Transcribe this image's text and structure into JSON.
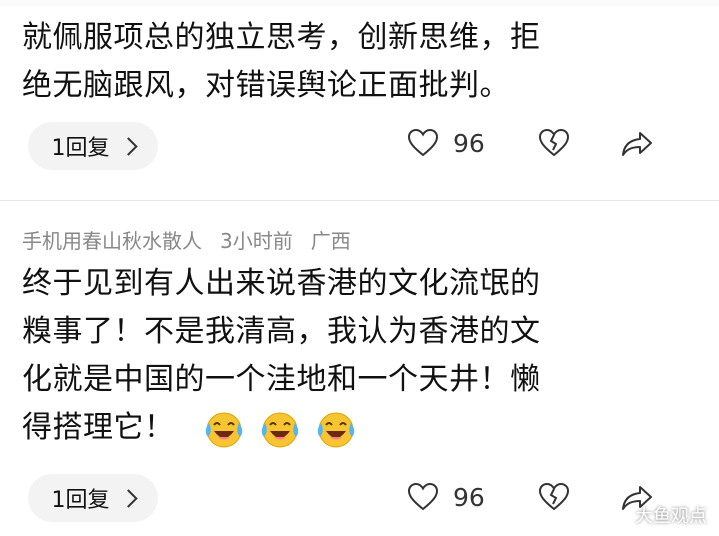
{
  "comments": [
    {
      "text_lines": [
        "就佩服项总的独立思考，创新思维，拒",
        "绝无脑跟风，对错误舆论正面批判。"
      ],
      "reply_label": "1回复",
      "likes": "96"
    },
    {
      "username": "手机用春山秋水散人",
      "time": "3小时前",
      "location": "广西",
      "text_lines": [
        "终于见到有人出来说香港的文化流氓的",
        "糗事了！不是我清高，我认为香港的文",
        "化就是中国的一个洼地和一个天井！懒",
        "得搭理它！"
      ],
      "emojis": [
        "laughing-crying-emoji",
        "laughing-crying-emoji",
        "laughing-crying-emoji"
      ],
      "reply_label": "1回复",
      "likes": "96"
    }
  ],
  "icons": {
    "like": "heart-icon",
    "dislike": "broken-heart-icon",
    "share": "share-arrow-icon"
  },
  "watermark": "大鱼观点",
  "colors": {
    "meta": "#888888",
    "pill_bg": "#f3f3f3",
    "text": "#111111"
  }
}
